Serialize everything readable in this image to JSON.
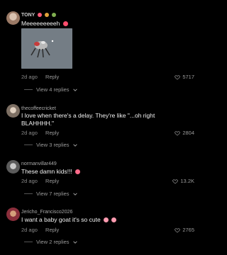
{
  "comments": [
    {
      "username": "TONY",
      "text": "Meeeeeeeeeh",
      "date": "2d ago",
      "reply_label": "Reply",
      "likes": "5717",
      "replies_label": "View 4 replies"
    },
    {
      "username": "thecoffeecricket",
      "text": "I love when there's a delay. They're like \"...oh right BLAHHHH.\"",
      "date": "2d ago",
      "reply_label": "Reply",
      "likes": "2804",
      "replies_label": "View 3 replies"
    },
    {
      "username": "normanvillar449",
      "text": "These damn kids!!!",
      "date": "2d ago",
      "reply_label": "Reply",
      "likes": "13.2K",
      "replies_label": "View 7 replies"
    },
    {
      "username": "Jericho_Francisco2026",
      "text": "I want a baby goat it's so cute",
      "date": "2d ago",
      "reply_label": "Reply",
      "likes": "2765",
      "replies_label": "View 2 replies"
    }
  ],
  "icons": {
    "like": "heart-outline-icon",
    "expand": "chevron-down-icon"
  },
  "colors": {
    "background": "#000000",
    "text": "#f2f2f2",
    "muted": "#8a8a8a"
  }
}
